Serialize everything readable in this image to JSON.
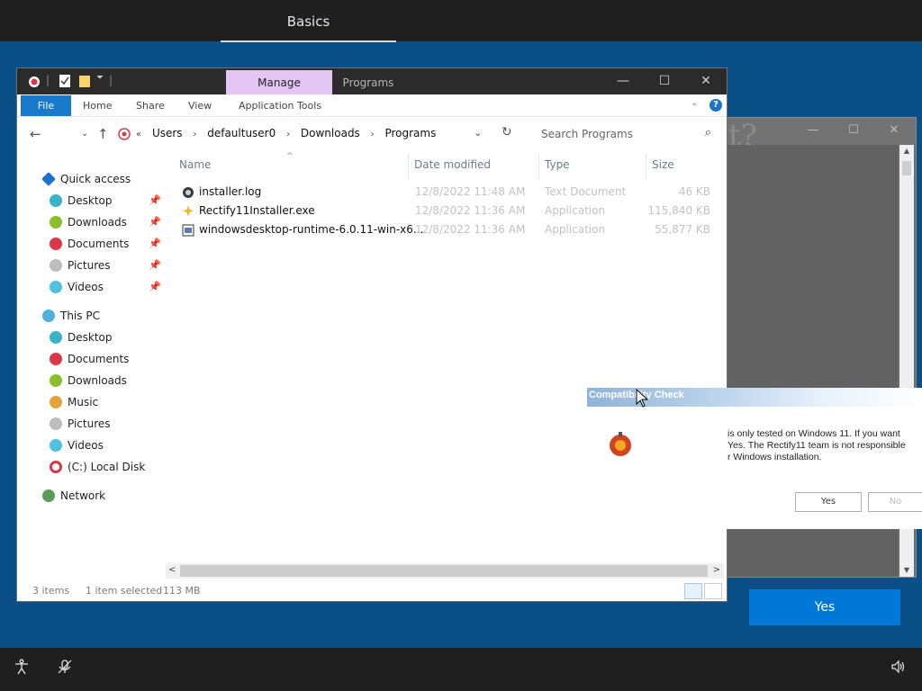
{
  "oobe": {
    "tab": "Basics",
    "yes_label": "Yes"
  },
  "explorer": {
    "ribbon_tabs": {
      "manage": "Manage",
      "programs": "Programs"
    },
    "menu": {
      "file": "File",
      "home": "Home",
      "share": "Share",
      "view": "View",
      "app_tools": "Application Tools"
    },
    "breadcrumb": [
      "Users",
      "defaultuser0",
      "Downloads",
      "Programs"
    ],
    "search_placeholder": "Search Programs",
    "nav": {
      "quick_access": "Quick access",
      "quick_items": [
        "Desktop",
        "Downloads",
        "Documents",
        "Pictures",
        "Videos"
      ],
      "this_pc": "This PC",
      "pc_items": [
        "Desktop",
        "Documents",
        "Downloads",
        "Music",
        "Pictures",
        "Videos",
        "(C:) Local Disk"
      ],
      "network": "Network"
    },
    "columns": {
      "name": "Name",
      "date": "Date modified",
      "type": "Type",
      "size": "Size"
    },
    "files": [
      {
        "name": "installer.log",
        "date": "12/8/2022 11:48 AM",
        "type": "Text Document",
        "size": "46 KB"
      },
      {
        "name": "Rectify11Installer.exe",
        "date": "12/8/2022 11:36 AM",
        "type": "Application",
        "size": "115,840 KB"
      },
      {
        "name": "windowsdesktop-runtime-6.0.11-win-x6...",
        "date": "12/8/2022 11:36 AM",
        "type": "Application",
        "size": "55,877 KB"
      }
    ],
    "status": {
      "count": "3 items",
      "selected": "1 item selected",
      "size": "113 MB"
    }
  },
  "compat": {
    "title": "Compatibility Check",
    "lines": [
      "is only tested on Windows 11. If you want",
      "Yes. The Rectify11 team is not responsible",
      "r Windows installation."
    ],
    "yes": "Yes",
    "no": "No"
  },
  "colors": {
    "oobe_bg": "#0b4f87",
    "accent": "#0078d7",
    "manage_tab": "#e4c6f5",
    "file_tab": "#1979ca"
  }
}
